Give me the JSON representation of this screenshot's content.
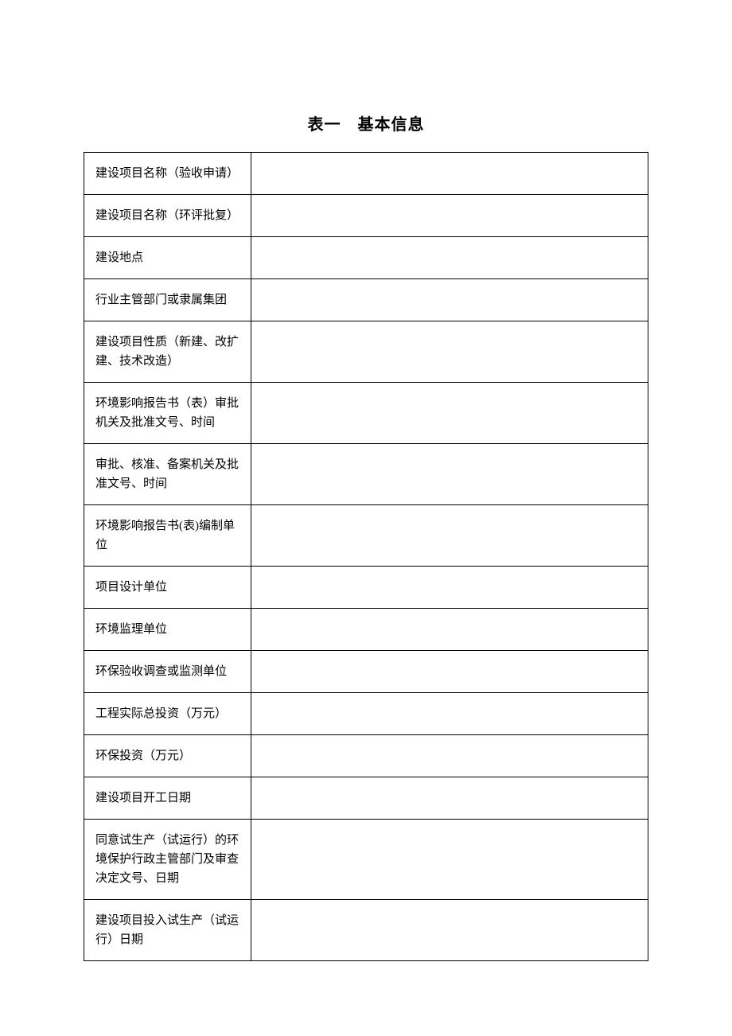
{
  "title": "表一　基本信息",
  "rows": [
    {
      "label": "建设项目名称（验收申请）",
      "value": ""
    },
    {
      "label": "建设项目名称（环评批复）",
      "value": ""
    },
    {
      "label": "建设地点",
      "value": ""
    },
    {
      "label": "行业主管部门或隶属集团",
      "value": ""
    },
    {
      "label": "建设项目性质（新建、改扩建、技术改造）",
      "value": ""
    },
    {
      "label": "环境影响报告书（表）审批机关及批准文号、时间",
      "value": ""
    },
    {
      "label": "审批、核准、备案机关及批准文号、时间",
      "value": ""
    },
    {
      "label": "环境影响报告书(表)编制单位",
      "value": ""
    },
    {
      "label": "项目设计单位",
      "value": ""
    },
    {
      "label": "环境监理单位",
      "value": ""
    },
    {
      "label": "环保验收调查或监测单位",
      "value": ""
    },
    {
      "label": "工程实际总投资（万元）",
      "value": ""
    },
    {
      "label": "环保投资（万元）",
      "value": ""
    },
    {
      "label": "建设项目开工日期",
      "value": ""
    },
    {
      "label": "同意试生产（试运行）的环境保护行政主管部门及审查决定文号、日期",
      "value": ""
    },
    {
      "label": "建设项目投入试生产（试运行）日期",
      "value": ""
    }
  ]
}
